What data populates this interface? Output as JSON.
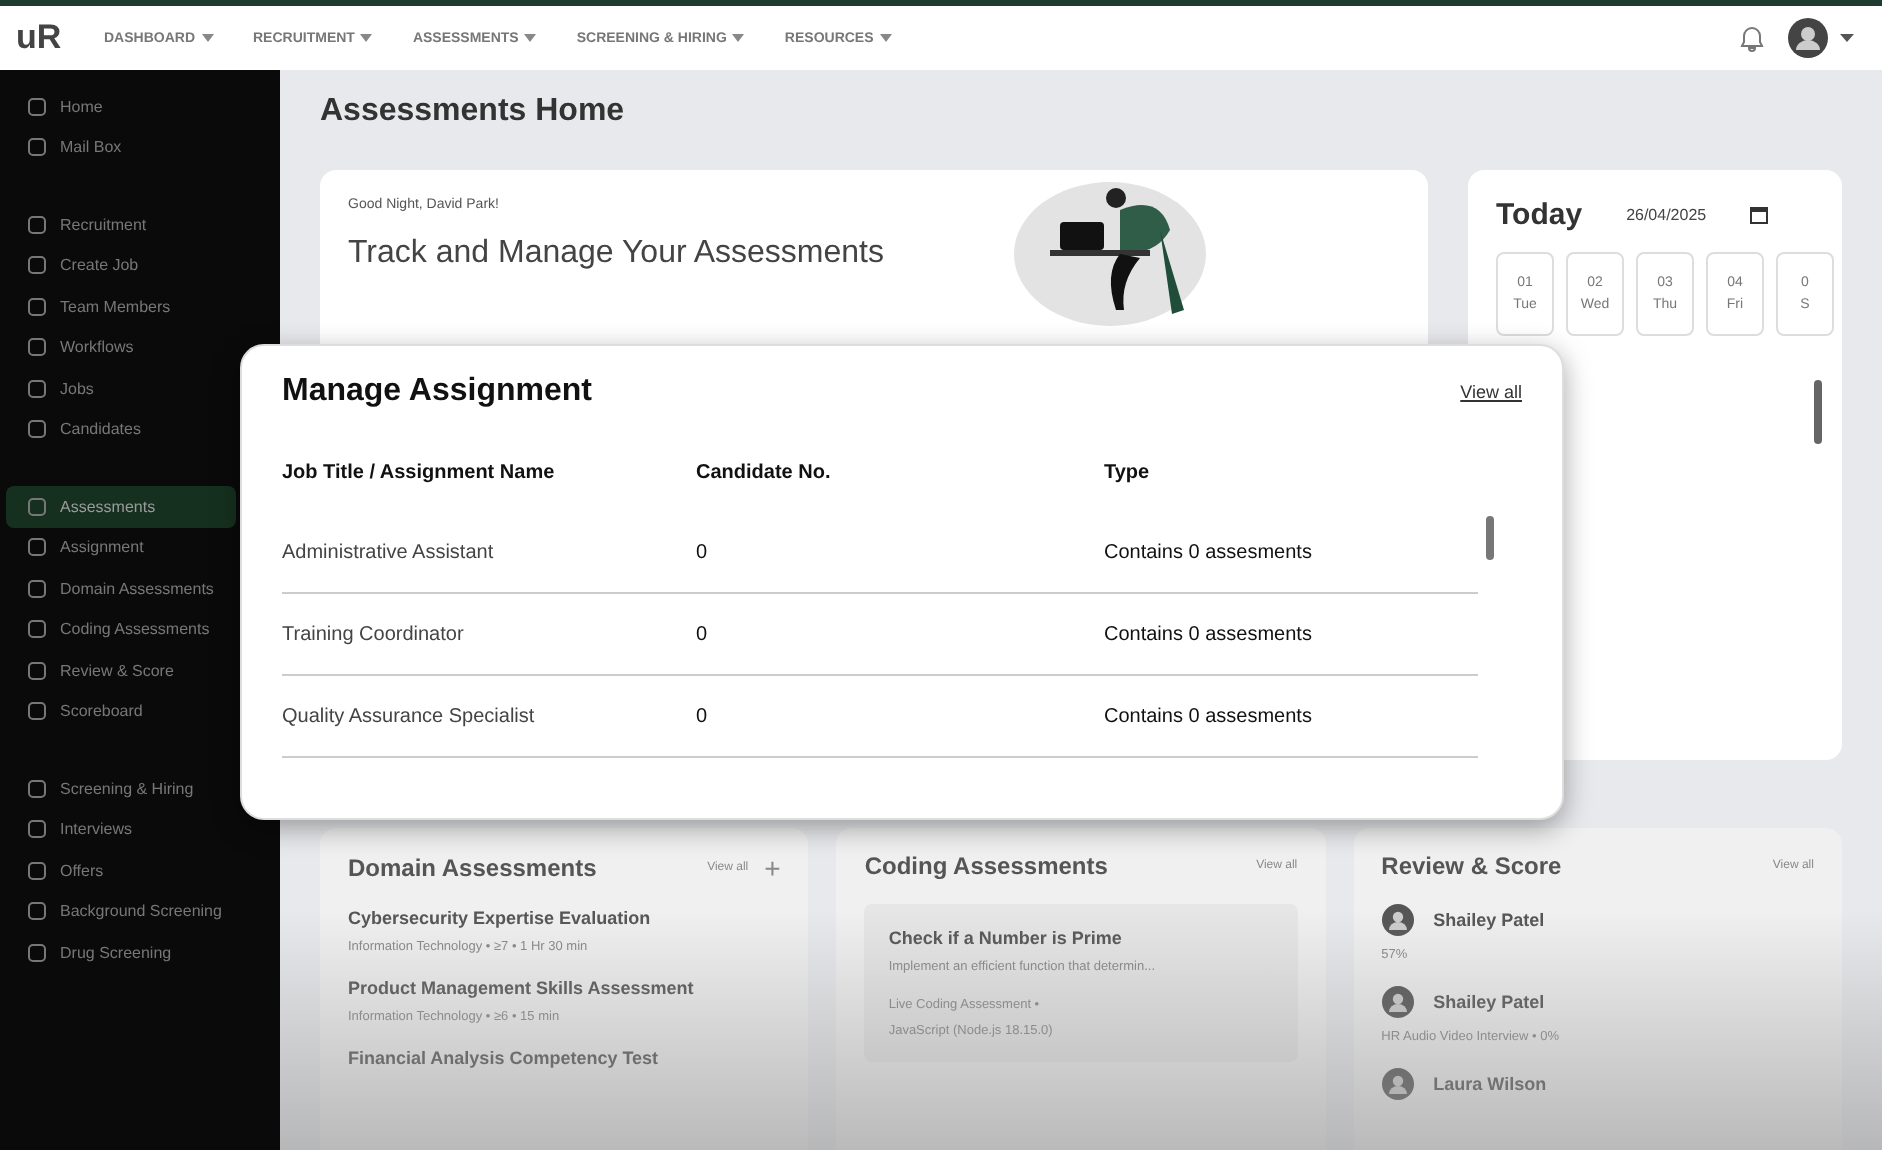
{
  "top_nav": {
    "logo": "uR",
    "menus": [
      {
        "label": "DASHBOARD"
      },
      {
        "label": "RECRUITMENT"
      },
      {
        "label": "ASSESSMENTS"
      },
      {
        "label": "SCREENING & HIRING"
      },
      {
        "label": "RESOURCES"
      }
    ]
  },
  "sidebar": {
    "groups": [
      {
        "items": [
          {
            "label": "Home",
            "selected": false
          },
          {
            "label": "Mail Box",
            "selected": false
          }
        ]
      },
      {
        "items": [
          {
            "label": "Recruitment",
            "selected": false
          },
          {
            "label": "Create Job",
            "selected": false
          },
          {
            "label": "Team Members",
            "selected": false
          },
          {
            "label": "Workflows",
            "selected": false
          },
          {
            "label": "Jobs",
            "selected": false
          },
          {
            "label": "Candidates",
            "selected": false
          }
        ]
      },
      {
        "items": [
          {
            "label": "Assessments",
            "selected": true
          },
          {
            "label": "Assignment",
            "selected": false
          },
          {
            "label": "Domain Assessments",
            "selected": false
          },
          {
            "label": "Coding Assessments",
            "selected": false
          },
          {
            "label": "Review & Score",
            "selected": false
          },
          {
            "label": "Scoreboard",
            "selected": false
          }
        ]
      },
      {
        "items": [
          {
            "label": "Screening & Hiring",
            "selected": false
          },
          {
            "label": "Interviews",
            "selected": false
          },
          {
            "label": "Offers",
            "selected": false
          },
          {
            "label": "Background Screening",
            "selected": false
          },
          {
            "label": "Drug Screening",
            "selected": false
          }
        ]
      }
    ]
  },
  "page_title": "Assessments Home",
  "welcome": {
    "greeting": "Good Night, David Park!",
    "heading": "Track and Manage Your Assessments"
  },
  "today": {
    "title": "Today",
    "date": "26/04/2025",
    "days": [
      {
        "num": "01",
        "day": "Tue"
      },
      {
        "num": "02",
        "day": "Wed"
      },
      {
        "num": "03",
        "day": "Thu"
      },
      {
        "num": "04",
        "day": "Fri"
      },
      {
        "num": "0",
        "day": "S"
      }
    ]
  },
  "manage_assignment": {
    "title": "Manage Assignment",
    "view_all": "View all",
    "columns": [
      "Job Title / Assignment Name",
      "Candidate No.",
      "Type"
    ],
    "rows": [
      [
        "Administrative Assistant",
        "0",
        "Contains 0 assesments"
      ],
      [
        "Training Coordinator",
        "0",
        "Contains 0 assesments"
      ],
      [
        "Quality Assurance Specialist",
        "0",
        "Contains 0 assesments"
      ]
    ]
  },
  "domain_assessments": {
    "title": "Domain Assessments",
    "view_all": "View all",
    "add": "+",
    "items": [
      {
        "title": "Cybersecurity Expertise Evaluation",
        "meta": "Information Technology • ≥7 • 1 Hr 30 min"
      },
      {
        "title": "Product Management Skills Assessment",
        "meta": "Information Technology • ≥6 • 15 min"
      },
      {
        "title": "Financial Analysis Competency Test"
      }
    ]
  },
  "coding_assessments": {
    "title": "Coding Assessments",
    "view_all": "View all",
    "items": [
      {
        "title": "Check if a Number is Prime",
        "description": "Implement an efficient function that determin...",
        "type": "Live Coding Assessment •",
        "language": "JavaScript (Node.js 18.15.0)"
      }
    ]
  },
  "review_score": {
    "title": "Review & Score",
    "view_all": "View all",
    "items": [
      {
        "name": "Shailey Patel",
        "detail": "57%"
      },
      {
        "name": "Shailey Patel",
        "detail": "HR Audio Video Interview • 0%"
      },
      {
        "name": "Laura Wilson"
      }
    ]
  }
}
